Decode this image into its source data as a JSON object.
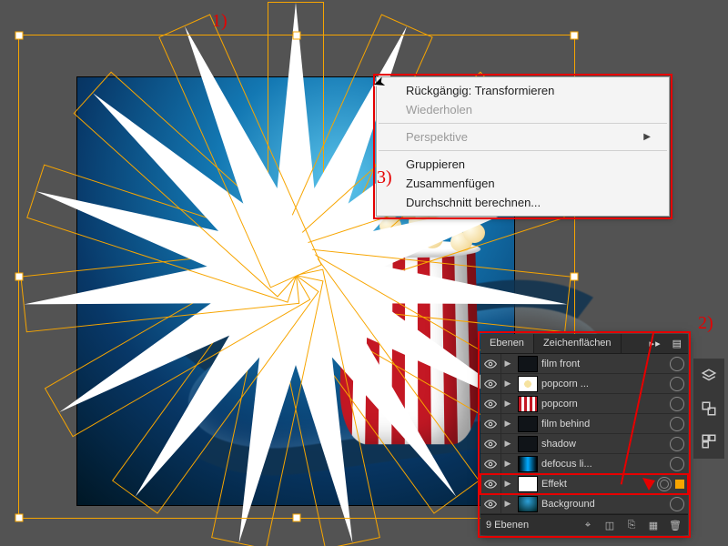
{
  "annotations": {
    "one": "1)",
    "two": "2)",
    "three": "3)"
  },
  "context_menu": {
    "undo": "Rückgängig: Transformieren",
    "redo": "Wiederholen",
    "perspective": "Perspektive",
    "group": "Gruppieren",
    "join": "Zusammenfügen",
    "average": "Durchschnitt berechnen..."
  },
  "layers_panel": {
    "tabs": {
      "layers": "Ebenen",
      "artboards": "Zeichenflächen"
    },
    "rows": [
      {
        "name": "film front",
        "thumb": "dark",
        "sel": false,
        "swatch": false,
        "truncated": true
      },
      {
        "name": "popcorn ...",
        "thumb": "pop",
        "sel": false,
        "swatch": false
      },
      {
        "name": "popcorn",
        "thumb": "bucket",
        "sel": false,
        "swatch": false
      },
      {
        "name": "film behind",
        "thumb": "dark",
        "sel": false,
        "swatch": false
      },
      {
        "name": "shadow",
        "thumb": "dark",
        "sel": false,
        "swatch": false
      },
      {
        "name": "defocus li...",
        "thumb": "defoc",
        "sel": false,
        "swatch": false
      },
      {
        "name": "Effekt",
        "thumb": "white",
        "sel": true,
        "swatch": true
      },
      {
        "name": "Background",
        "thumb": "bg",
        "sel": false,
        "swatch": false
      }
    ],
    "footer_count": "9 Ebenen"
  },
  "colors": {
    "accent": "#f7a500",
    "callout": "#e60000"
  }
}
